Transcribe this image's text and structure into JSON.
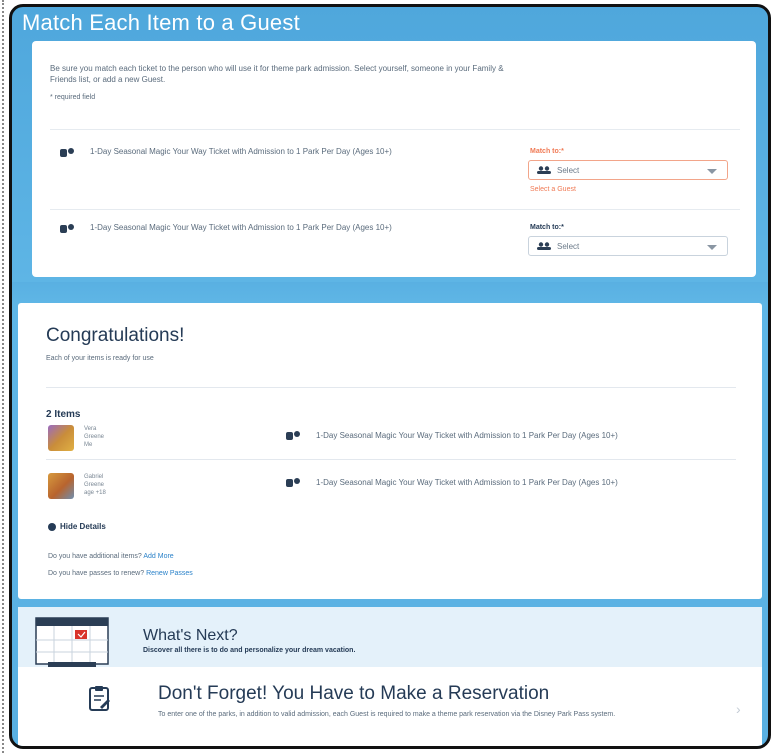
{
  "match_section": {
    "title": "Match Each Item to a Guest",
    "intro": "Be sure you match each ticket to the person who will use it for theme park admission. Select yourself, someone in your Family & Friends list, or add a new Guest.",
    "required_note": "* required field",
    "rows": [
      {
        "ticket": "1-Day Seasonal Magic Your Way Ticket with Admission to 1 Park Per Day (Ages 10+)",
        "match_label": "Match to:*",
        "select_value": "Select",
        "error": "Select a Guest"
      },
      {
        "ticket": "1-Day Seasonal Magic Your Way Ticket with Admission to 1 Park Per Day (Ages 10+)",
        "match_label": "Match to:*",
        "select_value": "Select",
        "error": ""
      }
    ]
  },
  "congrats": {
    "title": "Congratulations!",
    "subtitle": "Each of your items is ready for use",
    "items_heading": "2 Items",
    "items": [
      {
        "first": "Vera",
        "last": "Greene",
        "note": "Me",
        "ticket": "1-Day Seasonal Magic Your Way Ticket with Admission to 1 Park Per Day (Ages 10+)"
      },
      {
        "first": "Gabriel",
        "last": "Greene",
        "note": "age +18",
        "ticket": "1-Day Seasonal Magic Your Way Ticket with Admission to 1 Park Per Day (Ages 10+)"
      }
    ],
    "hide_details": "Hide Details",
    "additional_q": "Do you have additional items?",
    "add_more": "Add More",
    "passes_q": "Do you have passes to renew?",
    "renew_passes": "Renew Passes"
  },
  "whats_next": {
    "title": "What's Next?",
    "subtitle": "Discover all there is to do and personalize your dream vacation."
  },
  "reminder": {
    "title": "Don't Forget! You Have to Make a Reservation",
    "text": "To enter one of the parks, in addition to valid admission, each Guest is required to make a theme park reservation via the Disney Park Pass system."
  },
  "colors": {
    "accent_blue": "#59b0e2",
    "error_orange": "#f07a55",
    "link_blue": "#2b82c9"
  }
}
